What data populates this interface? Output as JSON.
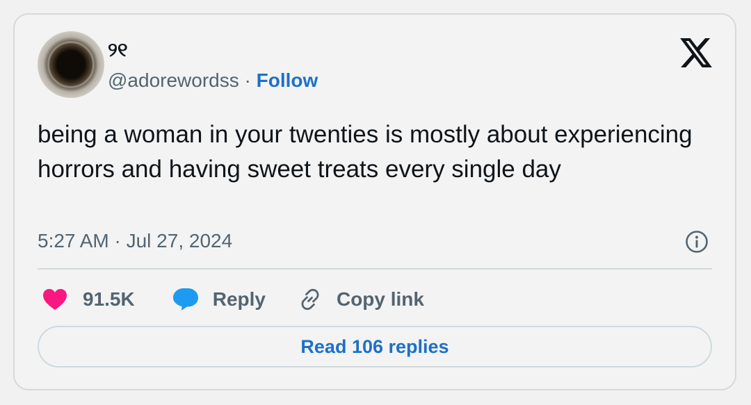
{
  "author": {
    "display_name": "୨୧",
    "handle": "@adorewordss",
    "separator": "·",
    "follow_label": "Follow"
  },
  "tweet": {
    "text": "being a woman in your twenties is mostly about experiencing horrors and having sweet treats every single day",
    "timestamp": "5:27 AM · Jul 27, 2024"
  },
  "actions": {
    "likes_count": "91.5K",
    "reply_label": "Reply",
    "copy_link_label": "Copy link"
  },
  "read_replies_label": "Read 106 replies",
  "colors": {
    "accent_blue": "#1d70c7",
    "like_pink": "#f91880",
    "reply_blue": "#1d9bf0",
    "secondary_text": "#536471",
    "primary_text": "#0f1419"
  },
  "icons": {
    "brand": "x-logo-icon",
    "info": "info-icon",
    "like": "heart-icon",
    "reply": "speech-bubble-icon",
    "copy": "link-icon"
  }
}
